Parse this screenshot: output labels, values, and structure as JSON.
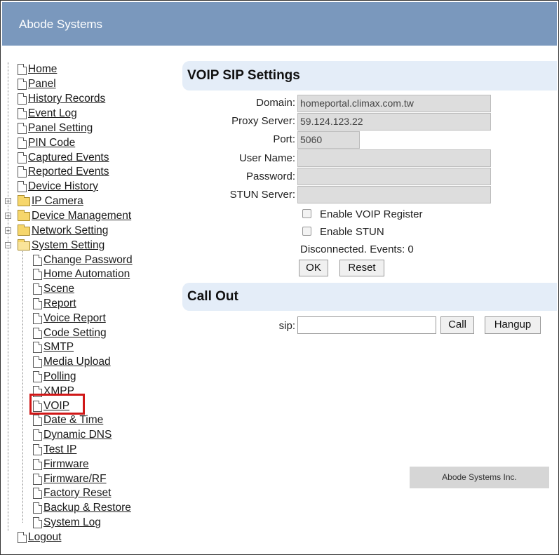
{
  "header": {
    "brand": "Abode Systems"
  },
  "sidebar": {
    "items": [
      {
        "label": "Home"
      },
      {
        "label": "Panel"
      },
      {
        "label": "History Records"
      },
      {
        "label": "Event Log"
      },
      {
        "label": "Panel Setting"
      },
      {
        "label": "PIN Code"
      },
      {
        "label": "Captured Events"
      },
      {
        "label": "Reported Events"
      },
      {
        "label": "Device History"
      },
      {
        "label": "IP Camera"
      },
      {
        "label": "Device Management"
      },
      {
        "label": "Network Setting"
      },
      {
        "label": "System Setting"
      },
      {
        "label": "Logout"
      }
    ],
    "system_children": [
      {
        "label": "Change Password"
      },
      {
        "label": "Home Automation"
      },
      {
        "label": "Scene"
      },
      {
        "label": "Report"
      },
      {
        "label": "Voice Report"
      },
      {
        "label": "Code Setting"
      },
      {
        "label": "SMTP"
      },
      {
        "label": "Media Upload"
      },
      {
        "label": "Polling"
      },
      {
        "label": "XMPP"
      },
      {
        "label": "VOIP"
      },
      {
        "label": "Date & Time"
      },
      {
        "label": "Dynamic DNS"
      },
      {
        "label": "Test IP"
      },
      {
        "label": "Firmware"
      },
      {
        "label": "Firmware/RF"
      },
      {
        "label": "Factory Reset"
      },
      {
        "label": "Backup & Restore"
      },
      {
        "label": "System Log"
      }
    ],
    "selected": "VOIP"
  },
  "voip": {
    "title": "VOIP SIP Settings",
    "domain_label": "Domain:",
    "domain_value": "homeportal.climax.com.tw",
    "proxy_label": "Proxy Server:",
    "proxy_value": "59.124.123.22",
    "port_label": "Port:",
    "port_value": "5060",
    "username_label": "User Name:",
    "username_value": "",
    "password_label": "Password:",
    "password_value": "",
    "stun_label": "STUN Server:",
    "stun_value": "",
    "enable_register_label": "Enable VOIP Register",
    "enable_stun_label": "Enable STUN",
    "status": "Disconnected. Events: 0",
    "ok_label": "OK",
    "reset_label": "Reset"
  },
  "callout": {
    "title": "Call Out",
    "sip_label": "sip:",
    "sip_value": "",
    "call_label": "Call",
    "hangup_label": "Hangup"
  },
  "footer": {
    "text": "Abode Systems Inc."
  }
}
